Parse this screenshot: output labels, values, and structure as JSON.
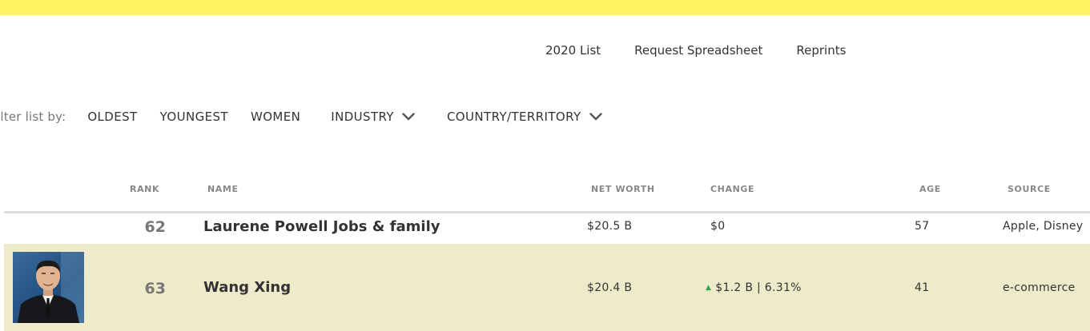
{
  "nav": {
    "items": [
      "2020 List",
      "Request Spreadsheet",
      "Reprints"
    ]
  },
  "filters": {
    "label": "ilter list by:",
    "options": [
      "OLDEST",
      "YOUNGEST",
      "WOMEN"
    ],
    "industry": "INDUSTRY",
    "country": "COUNTRY/TERRITORY"
  },
  "table": {
    "headers": {
      "rank": "RANK",
      "name": "NAME",
      "net_worth": "NET WORTH",
      "change": "CHANGE",
      "age": "AGE",
      "source": "SOURCE"
    },
    "rows": [
      {
        "rank": "62",
        "name": "Laurene Powell Jobs & family",
        "net_worth": "$20.5 B",
        "change": "$0",
        "age": "57",
        "source": "Apple, Disney"
      },
      {
        "rank": "63",
        "name": "Wang Xing",
        "net_worth": "$20.4 B",
        "change": "$1.2 B | 6.31%",
        "change_direction": "up",
        "age": "41",
        "source": "e-commerce",
        "highlighted": true
      }
    ]
  },
  "colors": {
    "top_bar": "#fff35f",
    "highlight_row": "#edebc9",
    "change_up": "#3aa14b"
  }
}
